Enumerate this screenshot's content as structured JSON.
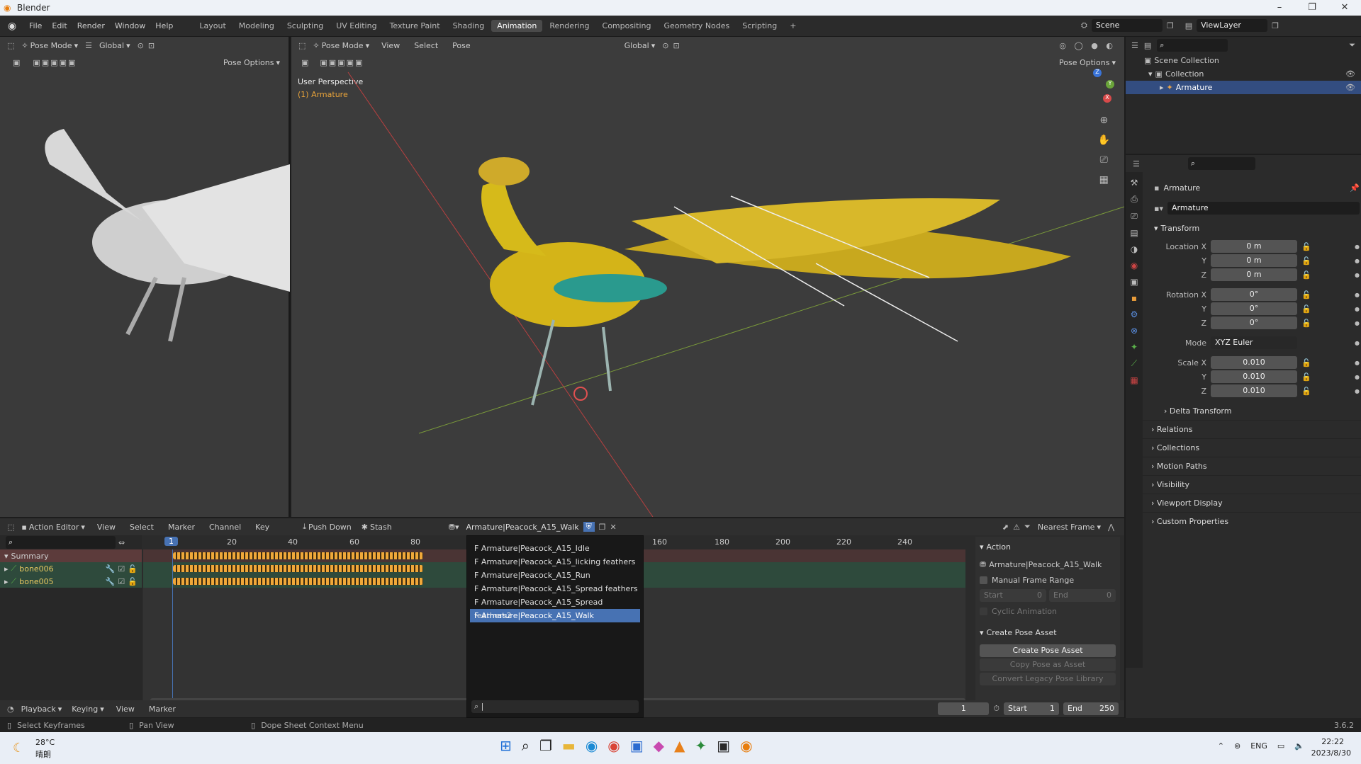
{
  "app": {
    "title": "Blender",
    "version": "3.6.2"
  },
  "window_controls": {
    "minimize": "–",
    "maximize": "❐",
    "close": "✕"
  },
  "top_menu": {
    "items": [
      "File",
      "Edit",
      "Render",
      "Window",
      "Help"
    ],
    "workspaces": [
      "Layout",
      "Modeling",
      "Sculpting",
      "UV Editing",
      "Texture Paint",
      "Shading",
      "Animation",
      "Rendering",
      "Compositing",
      "Geometry Nodes",
      "Scripting"
    ],
    "add_workspace": "+",
    "scene": "Scene",
    "view_layer": "ViewLayer"
  },
  "left_view": {
    "mode": "Pose Mode",
    "orientation": "Global",
    "pose_options": "Pose Options"
  },
  "main_view": {
    "mode": "Pose Mode",
    "menus": [
      "View",
      "Select",
      "Pose"
    ],
    "orientation": "Global",
    "pose_options": "Pose Options",
    "perspective": "User Perspective",
    "object": "(1) Armature"
  },
  "outliner": {
    "items": [
      {
        "label": "Scene Collection"
      },
      {
        "label": "Collection"
      },
      {
        "label": "Armature"
      }
    ]
  },
  "properties": {
    "object_name": "Armature",
    "data_name": "Armature",
    "transform": {
      "title": "Transform",
      "rows": [
        {
          "label": "Location X",
          "value": "0 m"
        },
        {
          "label": "Y",
          "value": "0 m"
        },
        {
          "label": "Z",
          "value": "0 m"
        },
        {
          "label": "Rotation X",
          "value": "0°"
        },
        {
          "label": "Y",
          "value": "0°"
        },
        {
          "label": "Z",
          "value": "0°"
        },
        {
          "label": "Mode",
          "value": "XYZ Euler"
        },
        {
          "label": "Scale X",
          "value": "0.010"
        },
        {
          "label": "Y",
          "value": "0.010"
        },
        {
          "label": "Z",
          "value": "0.010"
        }
      ]
    },
    "sections": [
      "Delta Transform",
      "Relations",
      "Collections",
      "Motion Paths",
      "Visibility",
      "Viewport Display",
      "Custom Properties"
    ]
  },
  "dopesheet": {
    "editor": "Action Editor",
    "menus": [
      "View",
      "Select",
      "Marker",
      "Channel",
      "Key"
    ],
    "push_down": "Push Down",
    "stash": "Stash",
    "action": "Armature|Peacock_A15_Walk",
    "snap": "Nearest Frame",
    "ruler": [
      "1",
      "20",
      "40",
      "60",
      "80",
      "160",
      "180",
      "200",
      "220",
      "240"
    ],
    "channels": [
      {
        "name": "Summary"
      },
      {
        "name": "bone006"
      },
      {
        "name": "bone005"
      }
    ],
    "action_list": [
      "F Armature|Peacock_A15_Idle",
      "F Armature|Peacock_A15_licking feathers",
      "F Armature|Peacock_A15_Run",
      "F Armature|Peacock_A15_Spread feathers",
      "F Armature|Peacock_A15_Spread feathers2",
      "F Armature|Peacock_A15_Walk"
    ],
    "sidebar": {
      "action_title": "Action",
      "action_name": "Armature|Peacock_A15_Walk",
      "manual_range": "Manual Frame Range",
      "start_label": "Start",
      "start": "0",
      "end_label": "End",
      "end": "0",
      "cyclic": "Cyclic Animation",
      "pose_title": "Create Pose Asset",
      "create_pose": "Create Pose Asset",
      "copy_pose": "Copy Pose as Asset",
      "convert": "Convert Legacy Pose Library"
    }
  },
  "timeline": {
    "menus": [
      "Playback",
      "Keying",
      "View",
      "Marker"
    ],
    "current": "1",
    "start_label": "Start",
    "start": "1",
    "end_label": "End",
    "end": "250"
  },
  "status": {
    "select": "Select Keyframes",
    "pan": "Pan View",
    "context": "Dope Sheet Context Menu"
  },
  "taskbar": {
    "temp": "28°C",
    "weather": "晴朗",
    "lang": "ENG",
    "time": "22:22",
    "date": "2023/8/30"
  }
}
